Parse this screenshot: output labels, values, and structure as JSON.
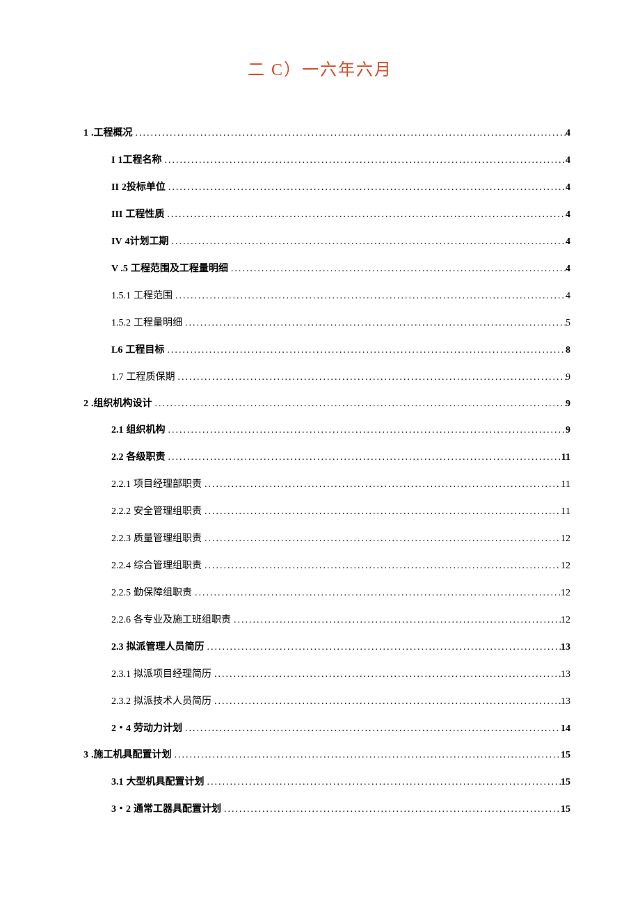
{
  "title": "二 C）一六年六月",
  "toc": [
    {
      "level": "top",
      "bold": true,
      "num": "1",
      "label": ".工程概况",
      "page": "4"
    },
    {
      "level": "sub",
      "bold": true,
      "num": "I",
      "label": "1工程名称",
      "page": "4"
    },
    {
      "level": "sub",
      "bold": true,
      "num": "II",
      "label": "2投标单位",
      "page": "4"
    },
    {
      "level": "sub",
      "bold": true,
      "num": "III",
      "label": "工程性质",
      "page": "4"
    },
    {
      "level": "sub",
      "bold": true,
      "num": "IV",
      "label": "4计划工期",
      "page": "4"
    },
    {
      "level": "sub",
      "bold": true,
      "num": "V .5",
      "label": "工程范围及工程量明细",
      "page": "4"
    },
    {
      "level": "sub",
      "bold": false,
      "num": "1.5.1",
      "label": "工程范围",
      "page": "4"
    },
    {
      "level": "sub",
      "bold": false,
      "num": "1.5.2",
      "label": "工程量明细",
      "page": "5"
    },
    {
      "level": "sub",
      "bold": true,
      "num": "L6",
      "label": "工程目标",
      "page": "8"
    },
    {
      "level": "sub",
      "bold": false,
      "num": "1.7",
      "label": "工程质保期",
      "page": "9"
    },
    {
      "level": "top",
      "bold": true,
      "num": "2",
      "label": ".组织机构设计",
      "page": "9"
    },
    {
      "level": "sub",
      "bold": true,
      "num": "2.1",
      "label": "组织机构",
      "page": "9"
    },
    {
      "level": "sub",
      "bold": true,
      "num": "2.2",
      "label": "各级职责",
      "page": "11"
    },
    {
      "level": "sub",
      "bold": false,
      "num": "2.2.1",
      "label": "项目经理部职责",
      "page": "11"
    },
    {
      "level": "sub",
      "bold": false,
      "num": "2.2.2",
      "label": "安全管理组职责",
      "page": "11"
    },
    {
      "level": "sub",
      "bold": false,
      "num": "2.2.3",
      "label": "质量管理组职责",
      "page": "12"
    },
    {
      "level": "sub",
      "bold": false,
      "num": "2.2.4",
      "label": "综合管理组职责",
      "page": "12"
    },
    {
      "level": "sub",
      "bold": false,
      "num": "2.2.5",
      "label": "勤保障组职责",
      "page": "12"
    },
    {
      "level": "sub",
      "bold": false,
      "num": "2.2.6",
      "label": "各专业及施工班组职责",
      "page": "12"
    },
    {
      "level": "sub",
      "bold": true,
      "num": "2.3",
      "label": "拟派管理人员简历",
      "page": "13"
    },
    {
      "level": "sub",
      "bold": false,
      "num": "2.3.1",
      "label": "拟派项目经理简历",
      "page": "13"
    },
    {
      "level": "sub",
      "bold": false,
      "num": "2.3.2",
      "label": "拟派技术人员简历",
      "page": "13"
    },
    {
      "level": "sub",
      "bold": true,
      "num": "2・4",
      "label": "劳动力计划",
      "page": "14"
    },
    {
      "level": "top",
      "bold": true,
      "num": "3",
      "label": ".施工机具配置计划",
      "page": "15"
    },
    {
      "level": "sub",
      "bold": true,
      "num": "3.1",
      "label": "大型机具配置计划",
      "page": "15"
    },
    {
      "level": "sub",
      "bold": true,
      "num": "3・2",
      "label": "通常工器具配置计划",
      "page": "15"
    }
  ]
}
